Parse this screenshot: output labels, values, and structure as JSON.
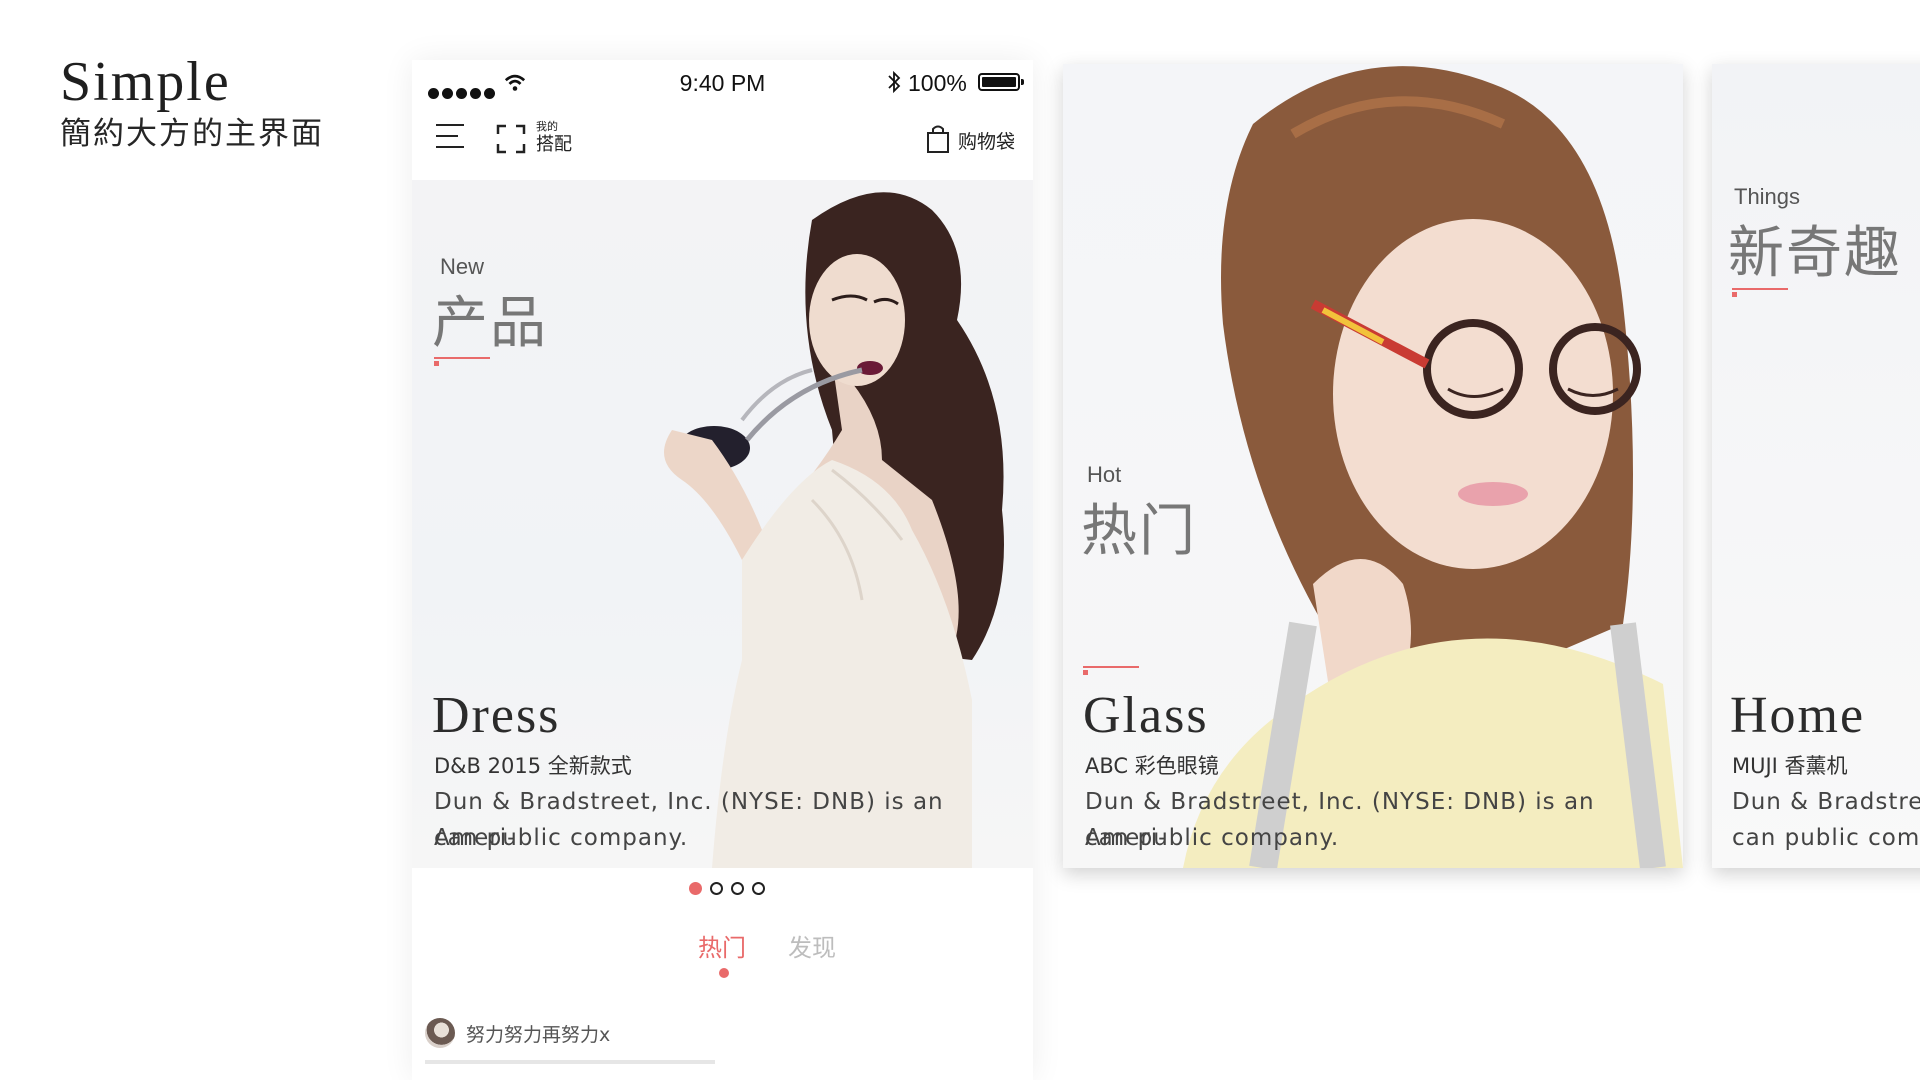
{
  "intro": {
    "title": "Simple",
    "subtitle": "簡約大方的主界面"
  },
  "statusbar": {
    "time": "9:40 PM",
    "battery": "100%"
  },
  "navbar": {
    "collocation_small": "我的",
    "collocation_big": "搭配",
    "bag_label": "购物袋"
  },
  "cards": [
    {
      "en_tag": "New",
      "cn_tag": "产品",
      "title": "Dress",
      "subtitle": "D&B 2015 全新款式",
      "desc_line1": "Dun & Bradstreet, Inc. (NYSE: DNB) is an Ameri-",
      "desc_line2": "can public company."
    },
    {
      "en_tag": "Hot",
      "cn_tag": "热门",
      "title": "Glass",
      "subtitle": "ABC 彩色眼镜",
      "desc_line1": "Dun & Bradstreet, Inc. (NYSE: DNB) is an Ameri-",
      "desc_line2": "can public company."
    },
    {
      "en_tag": "Things",
      "cn_tag": "新奇趣",
      "title": "Home",
      "subtitle": "MUJI 香薰机",
      "desc_line1": "Dun & Bradstree",
      "desc_line2": "can public comp"
    }
  ],
  "pager": {
    "active_index": 0,
    "count": 4
  },
  "tabs": {
    "hot": "热门",
    "discover": "发现"
  },
  "feed": {
    "username": "努力努力再努力x"
  },
  "colors": {
    "accent": "#e96a6a",
    "inactive_tab": "#bdbdbd"
  }
}
